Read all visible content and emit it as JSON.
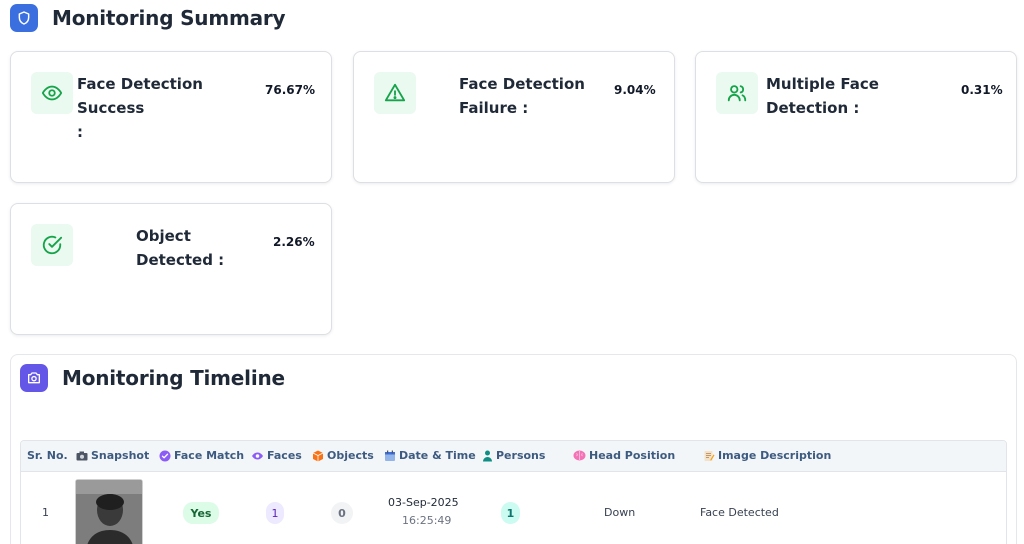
{
  "summary": {
    "title": "Monitoring Summary",
    "cards": [
      {
        "label_line1": "Face Detection Success",
        "label_line2": ":",
        "value": "76.67%",
        "icon": "eye-icon"
      },
      {
        "label_line1": "Face Detection",
        "label_line2": "Failure :",
        "value": "9.04%",
        "icon": "warning-triangle-icon"
      },
      {
        "label_line1": "Multiple Face Detection :",
        "label_line2": "",
        "value": "0.31%",
        "icon": "users-icon"
      },
      {
        "label_line1": "Object",
        "label_line2": "Detected :",
        "value": "2.26%",
        "icon": "check-circle-icon"
      }
    ]
  },
  "timeline": {
    "title": "Monitoring Timeline",
    "columns": [
      "Sr. No.",
      "Snapshot",
      "Face Match",
      "Faces",
      "Objects",
      "Date & Time",
      "Persons",
      "Head Position",
      "Image Description"
    ],
    "rows": [
      {
        "sr": "1",
        "face_match": "Yes",
        "faces": "1",
        "objects": "0",
        "date": "03-Sep-2025",
        "time": "16:25:49",
        "persons": "1",
        "head_position": "Down",
        "description": "Face Detected"
      }
    ]
  },
  "colors": {
    "accent": "#3b6fe0",
    "accent_purple": "#6457e8",
    "success_green": "#16a34a",
    "card_icon_bg": "#eafaf0",
    "header_text": "#3d5a80"
  }
}
